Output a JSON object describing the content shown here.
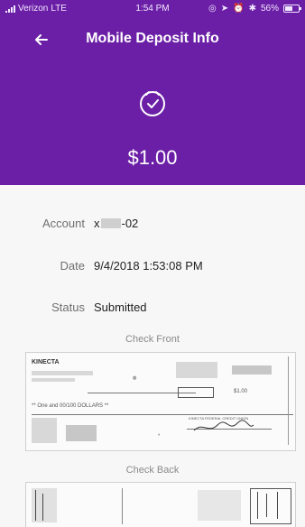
{
  "status_bar": {
    "carrier": "Verizon",
    "network": "LTE",
    "time": "1:54 PM",
    "battery": "56%"
  },
  "header": {
    "title": "Mobile Deposit Info",
    "amount": "$1.00",
    "back_icon": "back-arrow-icon",
    "status_icon": "clock-icon"
  },
  "details": {
    "account_label": "Account",
    "account_prefix": "x",
    "account_suffix": "-02",
    "date_label": "Date",
    "date_value": "9/4/2018 1:53:08 PM",
    "status_label": "Status",
    "status_value": "Submitted"
  },
  "images": {
    "front_label": "Check Front",
    "back_label": "Check Back"
  },
  "check_front": {
    "bank_name": "KINECTA",
    "written_amount": "** One and 00/100 DOLLARS **",
    "amount_box": "$1.00",
    "memo": "KINECTA FEDERAL CREDIT UNION"
  },
  "colors": {
    "brand": "#6b1fa6",
    "background": "#f7f7f7"
  }
}
